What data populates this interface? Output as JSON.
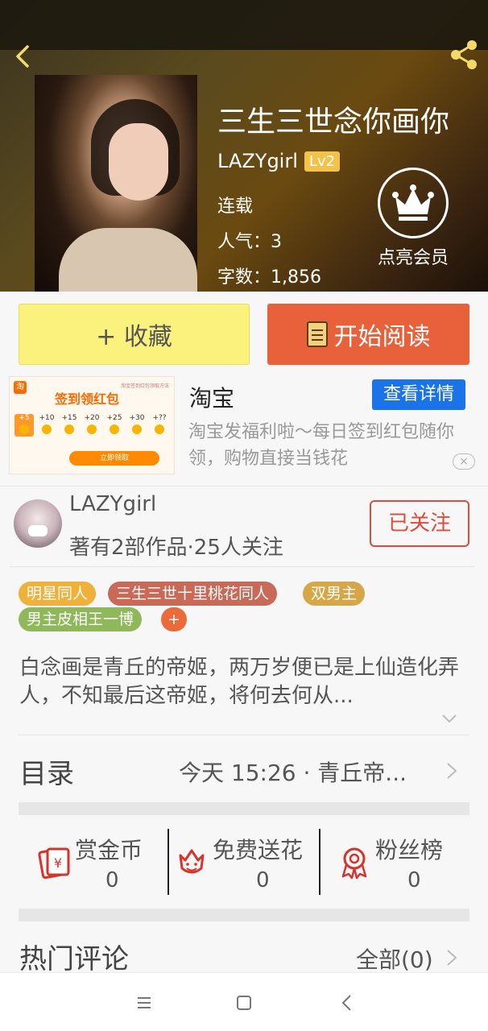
{
  "header": {
    "title": "三生三世念你画你",
    "author": "LAZYgirl",
    "level": "Lv2",
    "status": "连载",
    "popularity": "人气：3",
    "word_count": "字数：1,856",
    "vip_label": "点亮会员"
  },
  "actions": {
    "collect_label": "+ 收藏",
    "read_label": "开始阅读"
  },
  "ad": {
    "image_headline": "签到领红包",
    "image_tiny_text": "淘宝签到红包领取方法",
    "logo_char": "淘",
    "coins": [
      "+5",
      "+10",
      "+15",
      "+20",
      "+25",
      "+30",
      "+??"
    ],
    "image_button": "立即领取",
    "title": "淘宝",
    "detail_button": "查看详情",
    "description": "淘宝发福利啦～每日签到红包随你领，购物直接当钱花",
    "close": "×"
  },
  "author_card": {
    "name": "LAZYgirl",
    "stats": "著有2部作品·25人关注",
    "follow_label": "已关注"
  },
  "tags": [
    "明星同人",
    "三生三世十里桃花同人",
    "双男主",
    "男主皮相王一博",
    "+"
  ],
  "colors": {
    "tag_colors": [
      "#f0b13b",
      "#c96a58",
      "#d7a646",
      "#8fb85a",
      "#ea6a3a"
    ],
    "accent_red": "#e24a3a",
    "read_button": "#e8613a",
    "collect_button": "#fbf27e",
    "detail_button": "#1a73e8",
    "lv_badge": "#f2c24a"
  },
  "intro": {
    "text": "白念画是青丘的帝姬，两万岁便已是上仙造化弄人，不知最后这帝姬，将何去何从..."
  },
  "toc": {
    "label": "目录",
    "latest": "今天 15:26 · 青丘帝..."
  },
  "rewards": [
    {
      "label": "赏金币",
      "value": "0",
      "icon": "red-envelope-icon"
    },
    {
      "label": "免费送花",
      "value": "0",
      "icon": "flower-icon"
    },
    {
      "label": "粉丝榜",
      "value": "0",
      "icon": "medal-icon"
    }
  ],
  "comments": {
    "title": "热门评论",
    "all": "全部(0)"
  },
  "navbar": {
    "icons": [
      "menu-icon",
      "home-icon",
      "back-icon"
    ]
  }
}
